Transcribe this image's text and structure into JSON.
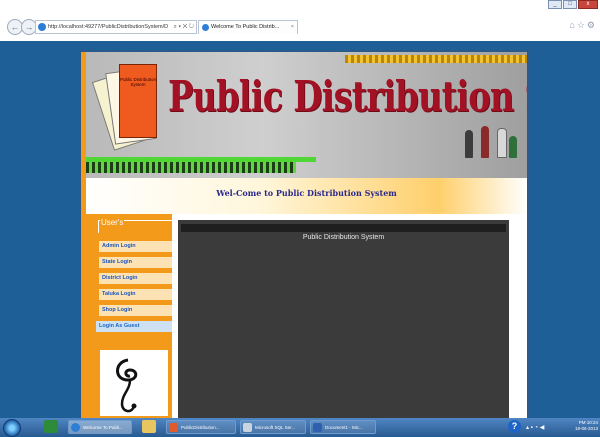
{
  "browser": {
    "address": "http://localhost:49277/PublicDistributionSystem/D",
    "tab_title": "Welcome To Public Distrib...",
    "tab_close": "×"
  },
  "site": {
    "title": "Public Distribution System",
    "book_text": "Public Distribution System",
    "welcome": "Wel-Come to Public Distribution System"
  },
  "sidebar": {
    "legend": "User's",
    "items": [
      {
        "label": "Admin Login"
      },
      {
        "label": "State Login"
      },
      {
        "label": "District Login"
      },
      {
        "label": "Taluka Login"
      },
      {
        "label": "Shop Login"
      },
      {
        "label": "Login As Guest"
      }
    ]
  },
  "content": {
    "title": "Public Distribution System"
  },
  "taskbar": {
    "items": [
      {
        "label": "Welcome To Publi..."
      },
      {
        "label": "PublicDistribution..."
      },
      {
        "label": "Microsoft SQL Ser..."
      },
      {
        "label": "Document1 - Mic..."
      }
    ],
    "time": "PM 10:24",
    "date": "18-06-2013"
  },
  "colors": {
    "background": "#1f5f97",
    "orange": "#f39a1a",
    "title_red": "#a31224",
    "link_blue": "#1a55c0"
  }
}
